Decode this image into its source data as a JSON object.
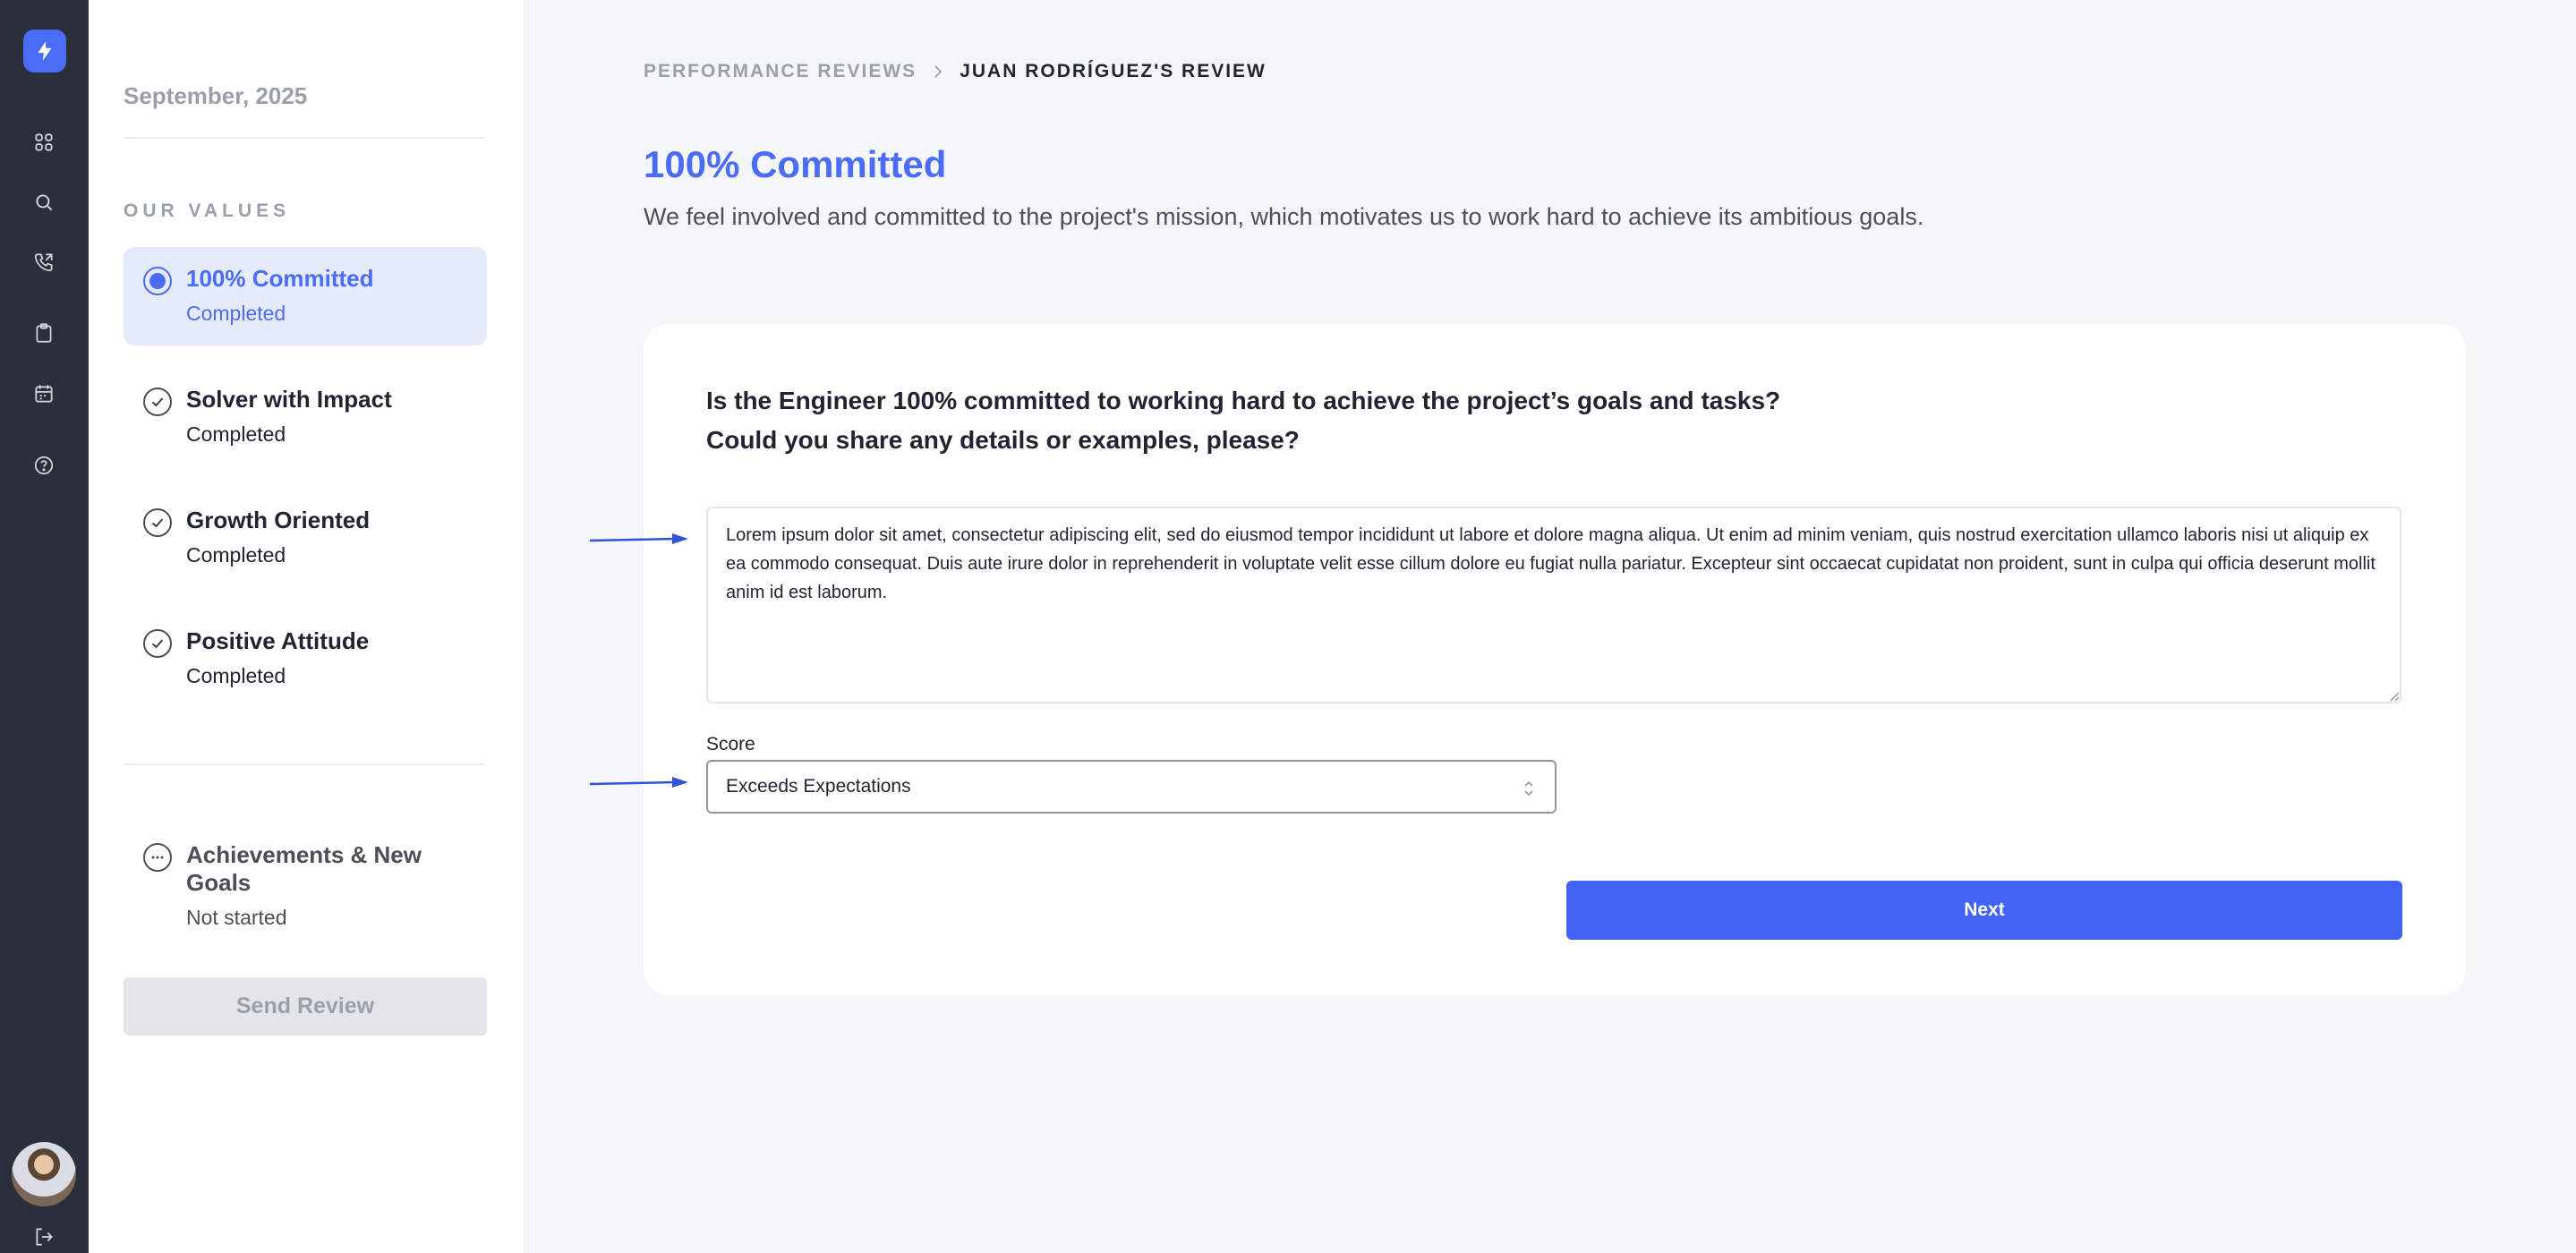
{
  "rail": {
    "logo_icon": "lightning-icon",
    "icons": [
      "grid-icon",
      "search-icon",
      "phone-icon",
      "clipboard-icon",
      "calendar-icon",
      "help-icon"
    ],
    "logout_icon": "logout-icon"
  },
  "panel": {
    "date": "September, 2025",
    "section_label": "OUR VALUES",
    "steps": [
      {
        "title": "100% Committed",
        "status": "Completed",
        "state": "active"
      },
      {
        "title": "Solver with Impact",
        "status": "Completed",
        "state": "done"
      },
      {
        "title": "Growth Oriented",
        "status": "Completed",
        "state": "done"
      },
      {
        "title": "Positive Attitude",
        "status": "Completed",
        "state": "done"
      }
    ],
    "extra_step": {
      "title": "Achievements & New Goals",
      "status": "Not started",
      "state": "pending"
    },
    "send_label": "Send Review"
  },
  "breadcrumb": {
    "parent": "PERFORMANCE REVIEWS",
    "current": "JUAN RODRÍGUEZ'S REVIEW"
  },
  "page": {
    "title": "100% Committed",
    "description": "We feel involved and committed to the project's mission, which motivates us to work hard to achieve its ambitious goals."
  },
  "form": {
    "question_line1": "Is the Engineer 100% committed to working hard to achieve the project’s goals and tasks?",
    "question_line2": "Could you share any details or examples, please?",
    "answer": "Lorem ipsum dolor sit amet, consectetur adipiscing elit, sed do eiusmod tempor incididunt ut labore et dolore magna aliqua. Ut enim ad minim veniam, quis nostrud exercitation ullamco laboris nisi ut aliquip ex ea commodo consequat. Duis aute irure dolor in reprehenderit in voluptate velit esse cillum dolore eu fugiat nulla pariatur. Excepteur sint occaecat cupidatat non proident, sunt in culpa qui officia deserunt mollit anim id est laborum.",
    "score_label": "Score",
    "score_value": "Exceeds Expectations",
    "next_label": "Next"
  },
  "colors": {
    "accent": "#4a6cf7",
    "rail_bg": "#2a2f3b",
    "active_bg": "#e6ebfb",
    "arrow": "#2f55d4"
  }
}
